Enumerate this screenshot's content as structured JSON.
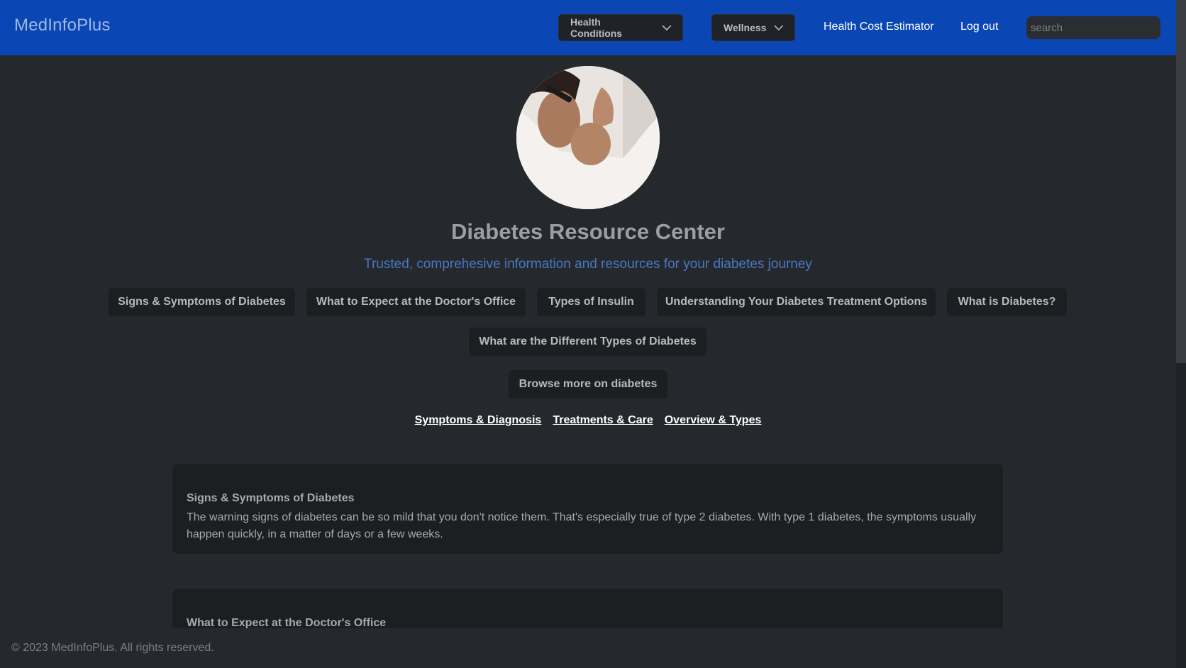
{
  "header": {
    "brand": "MedInfoPlus",
    "menus": [
      {
        "label": "Health Conditions"
      },
      {
        "label": "Wellness"
      }
    ],
    "links": {
      "cost_estimator": "Health Cost Estimator",
      "logout": "Log out"
    },
    "search": {
      "placeholder": "search",
      "value": ""
    },
    "color": "#0b47b4"
  },
  "hero": {
    "title": "Diabetes Resource Center",
    "subtitle": "Trusted, comprehesive information and resources for your diabetes journey"
  },
  "topics": [
    "Signs & Symptoms of Diabetes",
    "What to Expect at the Doctor's Office",
    "Types of Insulin",
    "Understanding Your Diabetes Treatment Options",
    "What is Diabetes?",
    "What are the Different Types of Diabetes"
  ],
  "browse_label": "Browse more on diabetes",
  "category_links": [
    "Symptoms & Diagnosis",
    "Treatments & Care",
    "Overview & Types"
  ],
  "cards": [
    {
      "title": "Signs & Symptoms of Diabetes",
      "body": "The warning signs of diabetes can be so mild that you don't notice them. That's especially true of type 2 diabetes. With type 1 diabetes, the symptoms usually happen quickly, in a matter of days or a few weeks."
    },
    {
      "title": "What to Expect at the Doctor's Office",
      "body": ""
    }
  ],
  "footer": {
    "copyright": "© 2023 MedInfoPlus. All rights reserved."
  }
}
